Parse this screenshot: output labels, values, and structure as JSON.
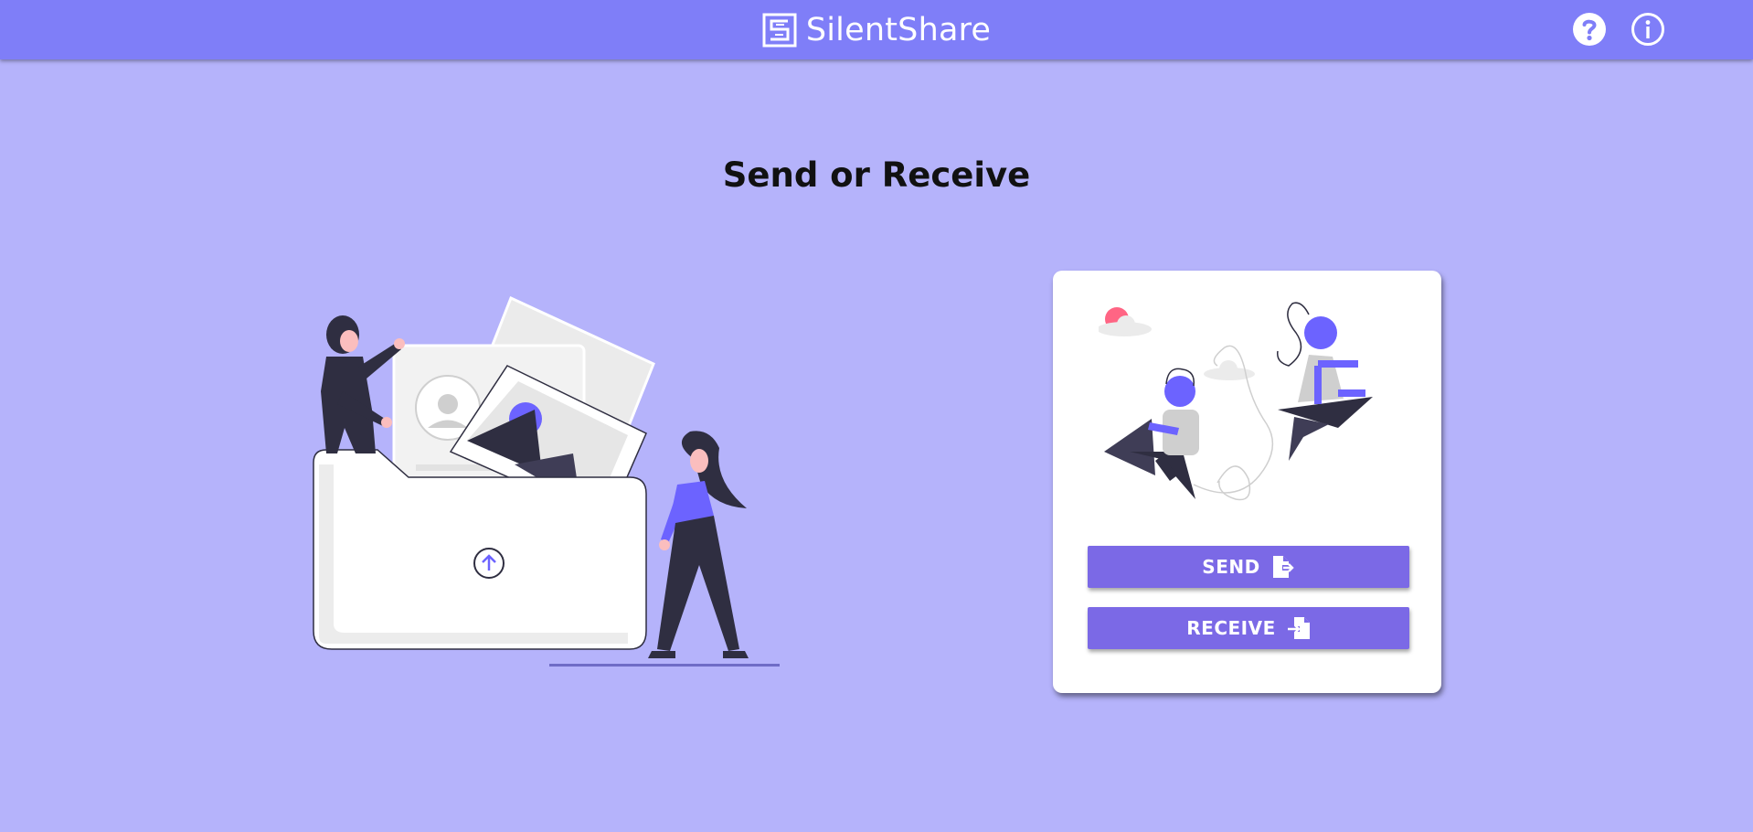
{
  "app": {
    "name": "SilentShare",
    "logo_icon": "logo-icon"
  },
  "header": {
    "help_icon": "help-icon",
    "info_icon": "info-icon"
  },
  "main": {
    "heading": "Send or Receive"
  },
  "card": {
    "send_label": "SEND",
    "send_icon": "file-export-icon",
    "receive_label": "RECEIVE",
    "receive_icon": "file-import-icon"
  },
  "colors": {
    "topbar": "#7f7ef8",
    "background": "#b5b3fb",
    "button": "#7b69e6",
    "accent": "#6c63ff",
    "dark": "#2f2e41"
  }
}
